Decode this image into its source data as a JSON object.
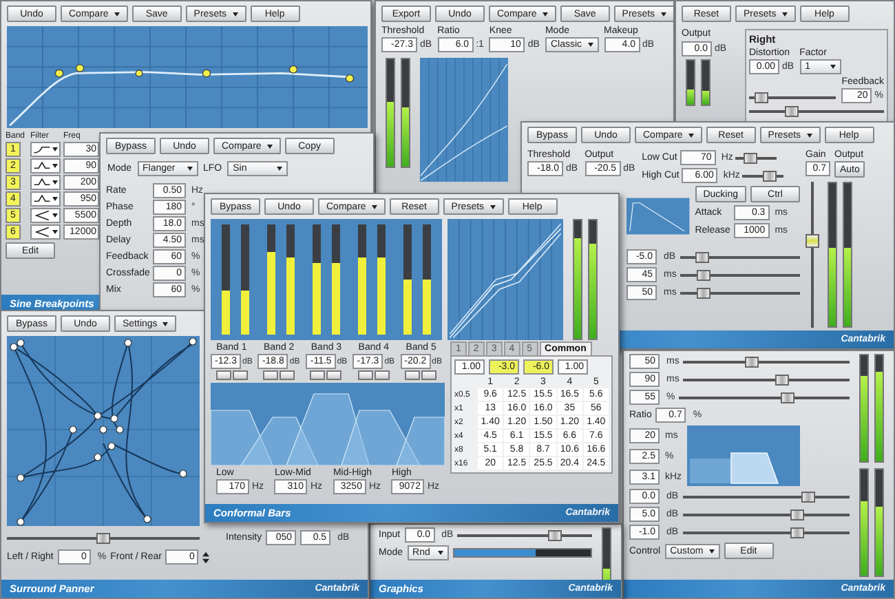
{
  "windows": [
    {
      "kind": "eq",
      "buttons": [
        {
          "label": "Undo",
          "dropdown": false
        },
        {
          "label": "Compare",
          "dropdown": true
        },
        {
          "label": "Save",
          "dropdown": false
        },
        {
          "label": "Presets",
          "dropdown": true
        },
        {
          "label": "Help",
          "dropdown": false
        }
      ],
      "band_headers": [
        "Band",
        "Filter",
        "Freq"
      ],
      "bands": [
        {
          "number": "1",
          "kind": "shelf",
          "freq": "30"
        },
        {
          "number": "2",
          "kind": "bell",
          "freq": "90"
        },
        {
          "number": "3",
          "kind": "bell",
          "freq": "200"
        },
        {
          "number": "4",
          "kind": "bell",
          "freq": "950"
        },
        {
          "number": "5",
          "kind": "lowpass",
          "freq": "5500"
        },
        {
          "number": "6",
          "kind": "lowpass",
          "freq": "12000"
        }
      ],
      "edit_button": "Edit",
      "footer": {
        "title": "Sine Breakpoints"
      }
    },
    {
      "kind": "compressor",
      "buttons": [
        {
          "label": "Export",
          "dropdown": false
        },
        {
          "label": "Undo",
          "dropdown": false
        },
        {
          "label": "Compare",
          "dropdown": true
        },
        {
          "label": "Save",
          "dropdown": false
        },
        {
          "label": "Presets",
          "dropdown": true
        }
      ],
      "fields": [
        {
          "kind": "field",
          "label": "Threshold",
          "value": "-27.3",
          "unit": "dB"
        },
        {
          "kind": "field",
          "label": "Ratio",
          "value": "6.0",
          "unit": ":1"
        },
        {
          "kind": "field",
          "label": "Knee",
          "value": "10",
          "unit": "dB"
        },
        {
          "kind": "select",
          "label": "Mode",
          "value": "Classic"
        },
        {
          "kind": "field",
          "label": "Makeup",
          "value": "4.0",
          "unit": "dB"
        }
      ],
      "meters": [
        {
          "level": 0.6
        },
        {
          "level": 0.55
        }
      ]
    },
    {
      "kind": "distortion",
      "buttons": [
        {
          "label": "Reset",
          "dropdown": false
        },
        {
          "label": "Presets",
          "dropdown": true
        },
        {
          "label": "Help",
          "dropdown": false
        }
      ],
      "output": {
        "label": "Output",
        "value": "0.0",
        "unit": "dB"
      },
      "meters": [
        {
          "level": 0.35
        },
        {
          "level": 0.3
        }
      ],
      "panel": {
        "title": "Right",
        "items": [
          {
            "kind": "field",
            "label": "Distortion",
            "value": "0.00",
            "unit": "dB"
          },
          {
            "kind": "select",
            "label": "Factor",
            "value": "1"
          },
          {
            "kind": "slider",
            "level": 0.08
          },
          {
            "kind": "field",
            "label": "Feedback",
            "value": "20",
            "unit": "%"
          },
          {
            "kind": "slider",
            "level": 0.3
          }
        ]
      }
    },
    {
      "kind": "flanger",
      "buttons": [
        {
          "label": "Bypass",
          "dropdown": false
        },
        {
          "label": "Undo",
          "dropdown": false
        },
        {
          "label": "Compare",
          "dropdown": true
        },
        {
          "label": "Copy",
          "dropdown": false
        }
      ],
      "mode": {
        "label": "Mode",
        "value": "Flanger"
      },
      "lfo": {
        "label": "LFO",
        "value": "Sin"
      },
      "params": [
        {
          "label": "Rate",
          "value": "0.50",
          "unit": "Hz"
        },
        {
          "label": "Phase",
          "value": "180",
          "unit": "°"
        },
        {
          "label": "Depth",
          "value": "18.0",
          "unit": "ms"
        },
        {
          "label": "Delay",
          "value": "4.50",
          "unit": "ms"
        },
        {
          "label": "Feedback",
          "value": "60",
          "unit": "%"
        },
        {
          "label": "Crossfade",
          "value": "0",
          "unit": "%"
        },
        {
          "label": "Mix",
          "value": "60",
          "unit": "%"
        }
      ]
    },
    {
      "kind": "dynamics",
      "buttons": [
        {
          "label": "Bypass",
          "dropdown": false
        },
        {
          "label": "Undo",
          "dropdown": false
        },
        {
          "label": "Compare",
          "dropdown": true
        },
        {
          "label": "Reset",
          "dropdown": false
        },
        {
          "label": "Presets",
          "dropdown": true
        },
        {
          "label": "Help",
          "dropdown": false
        }
      ],
      "fields": [
        {
          "label": "Threshold",
          "value": "-18.0",
          "unit": "dB"
        },
        {
          "label": "Output",
          "value": "-20.5",
          "unit": "dB"
        }
      ],
      "cuts": [
        {
          "label": "Low Cut",
          "value": "70",
          "unit": "Hz",
          "level": 0.3
        },
        {
          "label": "High Cut",
          "value": "6.00",
          "unit": "kHz",
          "level": 0.75
        }
      ],
      "gain": {
        "label": "Gain",
        "value": "0.7"
      },
      "auto": {
        "label": "Output",
        "button": "Auto"
      },
      "env_buttons": [
        "Ducking",
        "Ctrl"
      ],
      "env_fields": [
        {
          "label": "Attack",
          "value": "0.3",
          "unit": "ms"
        },
        {
          "label": "Release",
          "value": "1000",
          "unit": "ms"
        }
      ],
      "fader": {
        "level": 0.6
      },
      "sliders": [
        {
          "value": "-5.0",
          "unit": "dB",
          "level": 0.15
        },
        {
          "value": "45",
          "unit": "ms",
          "level": 0.15
        },
        {
          "value": "50",
          "unit": "ms",
          "level": 0.15
        }
      ],
      "meters": [
        {
          "level": 0.55
        },
        {
          "level": 0.55
        }
      ],
      "footer": {
        "brand": "Cantabrik"
      }
    },
    {
      "kind": "multiband",
      "buttons": [
        {
          "label": "Bypass",
          "dropdown": false
        },
        {
          "label": "Undo",
          "dropdown": false
        },
        {
          "label": "Compare",
          "dropdown": true
        },
        {
          "label": "Reset",
          "dropdown": false
        },
        {
          "label": "Presets",
          "dropdown": true
        },
        {
          "label": "Help",
          "dropdown": false
        }
      ],
      "bands": [
        {
          "name": "Band 1",
          "value": "-12.3",
          "unit": "dB",
          "meters": [
            {
              "level": 0.4
            },
            {
              "level": 0.4
            }
          ]
        },
        {
          "name": "Band 2",
          "value": "-18.8",
          "unit": "dB",
          "meters": [
            {
              "level": 0.75
            },
            {
              "level": 0.7
            }
          ]
        },
        {
          "name": "Band 3",
          "value": "-11.5",
          "unit": "dB",
          "meters": [
            {
              "level": 0.65
            },
            {
              "level": 0.65
            }
          ]
        },
        {
          "name": "Band 4",
          "value": "-17.3",
          "unit": "dB",
          "meters": [
            {
              "level": 0.7
            },
            {
              "level": 0.7
            }
          ]
        },
        {
          "name": "Band 5",
          "value": "-20.2",
          "unit": "dB",
          "meters": [
            {
              "level": 0.5
            },
            {
              "level": 0.5
            }
          ]
        }
      ],
      "meters": [
        {
          "level": 0.85
        },
        {
          "level": 0.8
        }
      ],
      "crossovers": [
        {
          "label": "Low",
          "value": "170",
          "unit": "Hz"
        },
        {
          "label": "Low-Mid",
          "value": "310",
          "unit": "Hz"
        },
        {
          "label": "Mid-High",
          "value": "3250",
          "unit": "Hz"
        },
        {
          "label": "High",
          "value": "9072",
          "unit": "Hz"
        }
      ],
      "tabs": [
        {
          "label": "1",
          "selected": false
        },
        {
          "label": "2",
          "selected": false
        },
        {
          "label": "3",
          "selected": false
        },
        {
          "label": "4",
          "selected": false
        },
        {
          "label": "5",
          "selected": false
        },
        {
          "label": "Common",
          "selected": true
        }
      ],
      "top_fields": [
        {
          "value": "1.00",
          "highlighted": false
        },
        {
          "value": "-3.0",
          "highlighted": true
        },
        {
          "value": "-6.0",
          "highlighted": true
        },
        {
          "value": "1.00",
          "highlighted": false
        }
      ],
      "columns": [
        "1",
        "2",
        "3",
        "4",
        "5"
      ],
      "rows": [
        {
          "label": "x0.5",
          "values": [
            "9.6",
            "12.5",
            "15.5",
            "16.5",
            "5.6"
          ]
        },
        {
          "label": "x1",
          "values": [
            "13",
            "16.0",
            "16.0",
            "35",
            "56"
          ]
        },
        {
          "label": "x2",
          "values": [
            "1.40",
            "1.20",
            "1.50",
            "1.20",
            "1.40"
          ]
        },
        {
          "label": "x4",
          "values": [
            "4.5",
            "6.1",
            "15.5",
            "6.6",
            "7.6"
          ]
        },
        {
          "label": "x8",
          "values": [
            "5.1",
            "5.8",
            "8.7",
            "10.6",
            "16.6"
          ]
        },
        {
          "label": "x16",
          "values": [
            "20",
            "12.5",
            "25.5",
            "20.4",
            "24.5"
          ]
        }
      ],
      "footer": {
        "title": "Conformal Bars",
        "brand": "Cantabrik"
      }
    },
    {
      "kind": "surround",
      "buttons": [
        {
          "label": "Bypass",
          "dropdown": false
        },
        {
          "label": "Undo",
          "dropdown": false
        },
        {
          "label": "Settings",
          "dropdown": true
        }
      ],
      "balance": {
        "level": 0.5
      },
      "intensity": {
        "label": "Intensity",
        "value": "050",
        "value2": "0.5",
        "unit": "dB"
      },
      "pans": [
        {
          "label": "Left / Right",
          "value": "0",
          "unit": "%"
        },
        {
          "label": "Front / Rear",
          "value": "0"
        }
      ],
      "footer": {
        "title": "Surround Panner",
        "brand": "Cantabrik"
      }
    },
    {
      "kind": "limiter",
      "input": {
        "label": "Input",
        "value": "0.0",
        "unit": "dB",
        "level": 0.75
      },
      "mode": {
        "label": "Mode",
        "value": "Rnd",
        "level": 0.6
      },
      "meters": [
        {
          "level": 0.5
        }
      ],
      "footer": {
        "title": "Graphics",
        "brand": "Cantabrik"
      }
    },
    {
      "kind": "mixer",
      "sliders_top": [
        {
          "value": "50",
          "unit": "ms",
          "level": 0.4
        },
        {
          "value": "90",
          "unit": "ms",
          "level": 0.6
        },
        {
          "value": "55",
          "unit": "%",
          "level": 0.65
        }
      ],
      "ratio": {
        "label": "Ratio",
        "value": "0.7",
        "unit": "%"
      },
      "side_fields": [
        {
          "value": "20",
          "unit": "ms"
        },
        {
          "value": "2.5",
          "unit": "%"
        },
        {
          "value": "3.1",
          "unit": "kHz"
        }
      ],
      "sliders_bottom": [
        {
          "value": "0.0",
          "unit": "dB",
          "level": 0.78
        },
        {
          "value": "5.0",
          "unit": "dB",
          "level": 0.7
        },
        {
          "value": "-1.0",
          "unit": "dB",
          "level": 0.7
        }
      ],
      "control": {
        "label": "Control",
        "value": "Custom",
        "button": "Edit"
      },
      "meter_groups": [
        [
          {
            "level": 0.8
          },
          {
            "level": 0.85
          }
        ],
        [
          {
            "level": 0.7
          },
          {
            "level": 0.65
          }
        ]
      ],
      "footer": {
        "brand": "Cantabrik"
      }
    }
  ]
}
